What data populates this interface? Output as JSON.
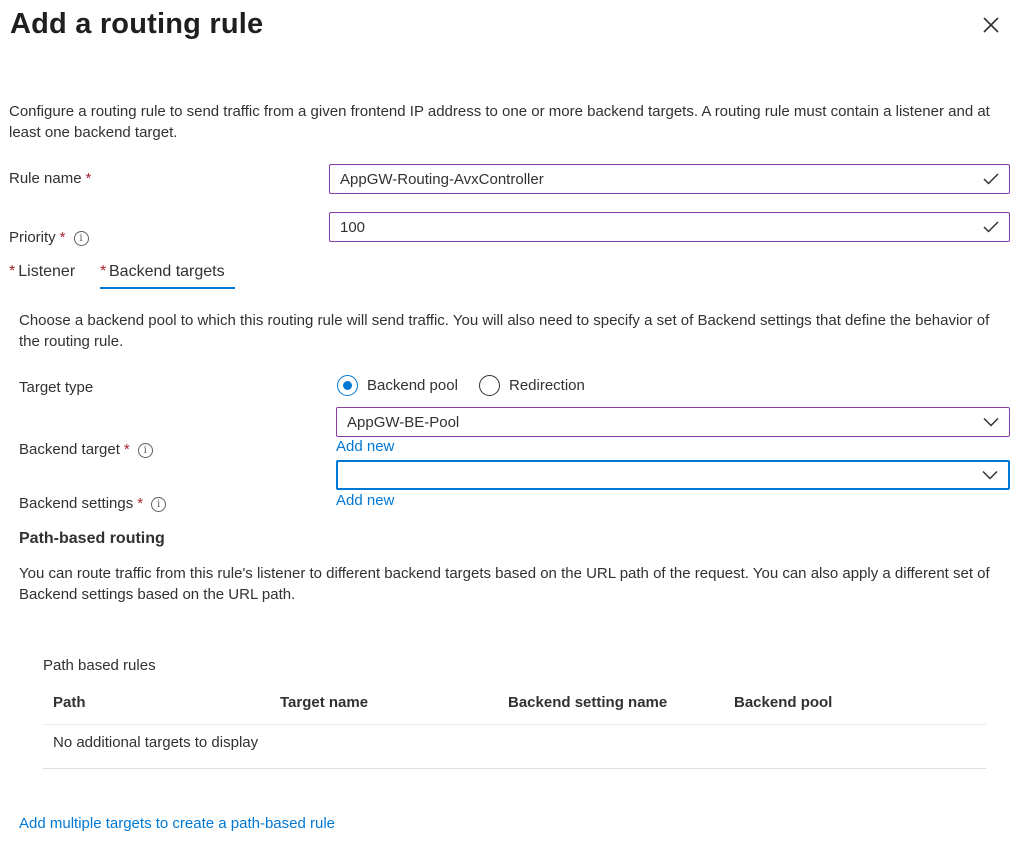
{
  "header": {
    "title": "Add a routing rule"
  },
  "intro": "Configure a routing rule to send traffic from a given frontend IP address to one or more backend targets. A routing rule must contain a listener and at least one backend target.",
  "rule_name": {
    "label": "Rule name",
    "value": "AppGW-Routing-AvxController"
  },
  "priority": {
    "label": "Priority",
    "value": "100"
  },
  "tabs": [
    {
      "label": "Listener"
    },
    {
      "label": "Backend targets"
    }
  ],
  "backend": {
    "intro": "Choose a backend pool to which this routing rule will send traffic. You will also need to specify a set of Backend settings that define the behavior of the routing rule.",
    "target_type_label": "Target type",
    "radio_backend_pool": "Backend pool",
    "radio_redirection": "Redirection",
    "backend_target_label": "Backend target",
    "backend_target_value": "AppGW-BE-Pool",
    "add_new_1": "Add new",
    "backend_settings_label": "Backend settings",
    "backend_settings_value": "",
    "add_new_2": "Add new"
  },
  "path_routing": {
    "heading": "Path-based routing",
    "desc": "You can route traffic from this rule's listener to different backend targets based on the URL path of the request. You can also apply a different set of Backend settings based on the URL path.",
    "table_title": "Path based rules",
    "columns": [
      "Path",
      "Target name",
      "Backend setting name",
      "Backend pool"
    ],
    "empty_text": "No additional targets to display",
    "add_link": "Add multiple targets to create a path-based rule"
  },
  "icons": {
    "close": "close-icon",
    "check": "checkmark-icon",
    "chevron": "chevron-down-icon",
    "info": "info-icon"
  },
  "colors": {
    "accent": "#0078d4",
    "required": "#a4262c",
    "valid_border": "#8a3ba6"
  }
}
